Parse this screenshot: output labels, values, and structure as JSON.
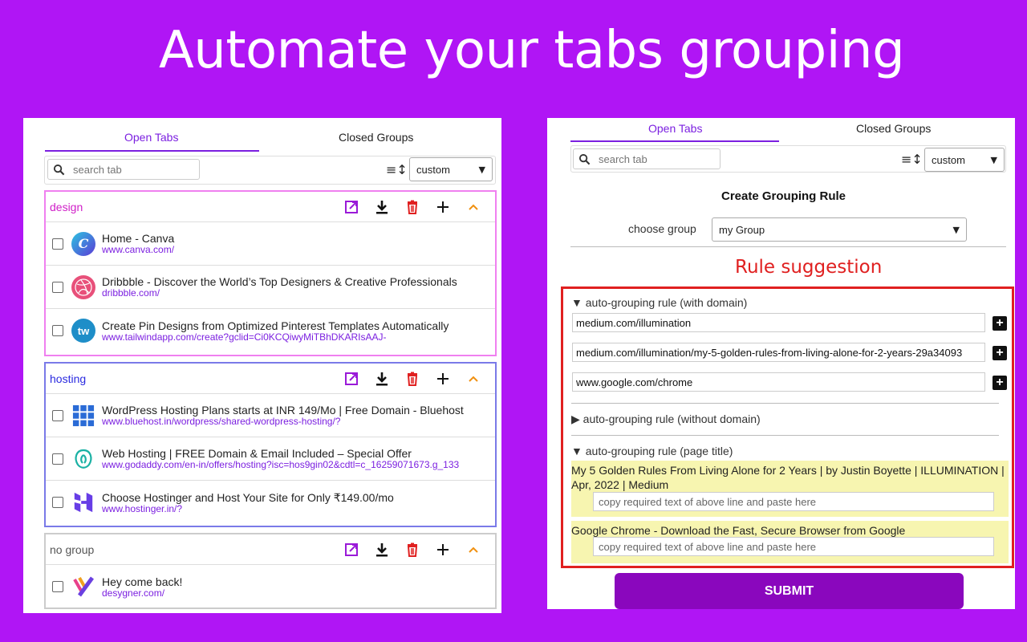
{
  "hero": {
    "title": "Automate your tabs grouping"
  },
  "colors": {
    "background": "#b015f5",
    "accent": "#7b1fe0",
    "design_border": "#f080f0",
    "hosting_border": "#7a7ae8",
    "nogroup_border": "#cccccc",
    "red": "#e02020",
    "submit": "#8a07bd"
  },
  "left": {
    "tabs": {
      "open": "Open Tabs",
      "closed": "Closed Groups"
    },
    "search": {
      "placeholder": "search tab"
    },
    "sort": {
      "value": "custom"
    },
    "groups": [
      {
        "name": "design",
        "tabs": [
          {
            "title": "Home - Canva",
            "url": "www.canva.com/",
            "icon": "canva-icon"
          },
          {
            "title": "Dribbble - Discover the World’s Top Designers & Creative Professionals",
            "url": "dribbble.com/",
            "icon": "dribbble-icon"
          },
          {
            "title": "Create Pin Designs from Optimized Pinterest Templates Automatically",
            "url": "www.tailwindapp.com/create?gclid=Ci0KCQiwyMiTBhDKARIsAAJ-",
            "icon": "tailwind-icon"
          }
        ]
      },
      {
        "name": "hosting",
        "tabs": [
          {
            "title": "WordPress Hosting Plans starts at INR 149/Mo | Free Domain - Bluehost",
            "url": "www.bluehost.in/wordpress/shared-wordpress-hosting/?",
            "icon": "bluehost-icon"
          },
          {
            "title": "Web Hosting | FREE Domain & Email Included – Special Offer",
            "url": "www.godaddy.com/en-in/offers/hosting?isc=hos9gin02&cdtl=c_16259071673.g_133",
            "icon": "godaddy-icon"
          },
          {
            "title": "Choose Hostinger and Host Your Site for Only ₹149.00/mo",
            "url": "www.hostinger.in/?",
            "icon": "hostinger-icon"
          }
        ]
      },
      {
        "name": "no group",
        "tabs": [
          {
            "title": "Hey come back!",
            "url": "desygner.com/",
            "icon": "desygner-icon"
          }
        ]
      }
    ]
  },
  "right": {
    "tabs": {
      "open": "Open Tabs",
      "closed": "Closed Groups"
    },
    "search": {
      "placeholder": "search tab"
    },
    "sort": {
      "value": "custom"
    },
    "create_title": "Create Grouping Rule",
    "choose_group_label": "choose group",
    "choose_group_value": "my Group",
    "suggestion_label": "Rule suggestion",
    "rule_domain_summary": "▼ auto-grouping rule (with domain)",
    "domain_rules": [
      "medium.com/illumination",
      "medium.com/illumination/my-5-golden-rules-from-living-alone-for-2-years-29a34093",
      "www.google.com/chrome"
    ],
    "rule_nodomain_summary": "▶ auto-grouping rule (without domain)",
    "rule_title_summary": "▼ auto-grouping rule (page title)",
    "page_titles": [
      {
        "text": "My 5 Golden Rules From Living Alone for 2 Years | by Justin Boyette | ILLUMINATION | Apr, 2022 | Medium",
        "placeholder": "copy required text of above line and paste here"
      },
      {
        "text": "Google Chrome - Download the Fast, Secure Browser from Google",
        "placeholder": "copy required text of above line and paste here"
      }
    ],
    "submit_label": "SUBMIT"
  }
}
